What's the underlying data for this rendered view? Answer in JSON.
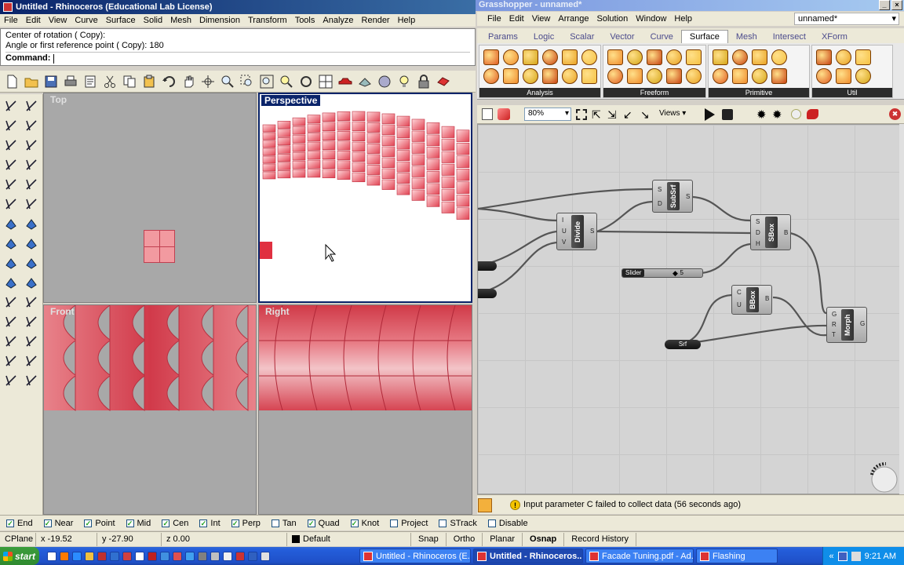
{
  "rhino": {
    "title": "Untitled - Rhinoceros (Educational Lab License)",
    "menu": [
      "File",
      "Edit",
      "View",
      "Curve",
      "Surface",
      "Solid",
      "Mesh",
      "Dimension",
      "Transform",
      "Tools",
      "Analyze",
      "Render",
      "Help"
    ],
    "command_history": [
      "Center of rotation ( Copy):",
      "Angle or first reference point ( Copy): 180"
    ],
    "command_prompt": "Command:",
    "viewports": {
      "top": "Top",
      "perspective": "Perspective",
      "front": "Front",
      "right": "Right"
    }
  },
  "grasshopper": {
    "title": "Grasshopper - unnamed*",
    "menu": [
      "File",
      "Edit",
      "View",
      "Arrange",
      "Solution",
      "Window",
      "Help"
    ],
    "document_name": "unnamed*",
    "tabs": [
      "Params",
      "Logic",
      "Scalar",
      "Vector",
      "Curve",
      "Surface",
      "Mesh",
      "Intersect",
      "XForm"
    ],
    "active_tab": "Surface",
    "ribbon_groups": [
      "Analysis",
      "Freeform",
      "Primitive",
      "Util"
    ],
    "zoom": "80%",
    "views_label": "Views",
    "components": {
      "subsrf": {
        "name": "SubSrf",
        "inputs": [
          "S",
          "D"
        ],
        "outputs": [
          "S"
        ]
      },
      "divide": {
        "name": "Divide",
        "inputs": [
          "I",
          "U",
          "V"
        ],
        "outputs": [
          "S"
        ]
      },
      "sbox": {
        "name": "SBox",
        "inputs": [
          "S",
          "D",
          "H"
        ],
        "outputs": [
          "B"
        ]
      },
      "bbox": {
        "name": "BBox",
        "inputs": [
          "C",
          "U"
        ],
        "outputs": [
          "B"
        ]
      },
      "morph": {
        "name": "Morph",
        "inputs": [
          "G",
          "R",
          "T"
        ],
        "outputs": [
          "G"
        ]
      }
    },
    "slider": {
      "label": "Slider",
      "value": "5"
    },
    "srf_param": "Srf",
    "status_message": "Input parameter C failed to collect data (56 seconds ago)"
  },
  "osnap": [
    {
      "label": "End",
      "checked": true
    },
    {
      "label": "Near",
      "checked": true
    },
    {
      "label": "Point",
      "checked": true
    },
    {
      "label": "Mid",
      "checked": true
    },
    {
      "label": "Cen",
      "checked": true
    },
    {
      "label": "Int",
      "checked": true
    },
    {
      "label": "Perp",
      "checked": true
    },
    {
      "label": "Tan",
      "checked": false
    },
    {
      "label": "Quad",
      "checked": true
    },
    {
      "label": "Knot",
      "checked": true
    },
    {
      "label": "Project",
      "checked": false
    },
    {
      "label": "STrack",
      "checked": false
    },
    {
      "label": "Disable",
      "checked": false
    }
  ],
  "status": {
    "cplane": "CPlane",
    "x": "x -19.52",
    "y": "y -27.90",
    "z": "z 0.00",
    "layer": "Default",
    "buttons": [
      "Snap",
      "Ortho",
      "Planar",
      "Osnap",
      "Record History"
    ],
    "active_button": "Osnap"
  },
  "taskbar": {
    "start": "start",
    "items": [
      "Untitled - Rhinoceros (E...",
      "Untitled - Rhinoceros...",
      "Facade Tuning.pdf - Ad...",
      "Flashing"
    ],
    "active_item": 1,
    "clock": "9:21 AM"
  },
  "colors": {
    "title_active": "#0a246a",
    "panel_red": "#e0505a",
    "viewport_bg": "#a8a8a8",
    "perspective_bg": "#ffffff",
    "canvas_bg": "#d4d4d4"
  }
}
